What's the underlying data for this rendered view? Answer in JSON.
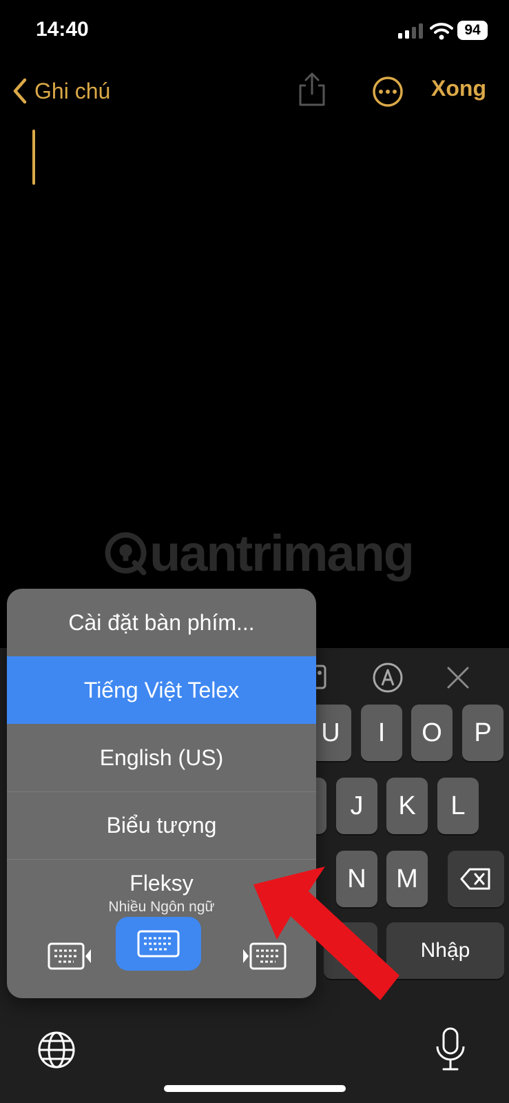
{
  "status_bar": {
    "time": "14:40",
    "battery": "94"
  },
  "nav": {
    "back_label": "Ghi chú",
    "done_label": "Xong"
  },
  "watermark": {
    "text": "uantrimang"
  },
  "keyboard": {
    "row1": [
      "U",
      "I",
      "O",
      "P"
    ],
    "row2": [
      "J",
      "K",
      "L"
    ],
    "row3": [
      "N",
      "M"
    ],
    "return_label": "Nhập"
  },
  "keyboard_menu": {
    "settings": "Cài đặt bàn phím...",
    "items": [
      {
        "label": "Tiếng Việt Telex",
        "selected": true
      },
      {
        "label": "English (US)",
        "selected": false
      },
      {
        "label": "Biểu tượng",
        "selected": false
      },
      {
        "label": "Fleksy",
        "sublabel": "Nhiều Ngôn ngữ",
        "selected": false
      }
    ]
  },
  "colors": {
    "accent": "#dba948",
    "selected": "#3f88f2",
    "arrow": "#e8141b"
  }
}
